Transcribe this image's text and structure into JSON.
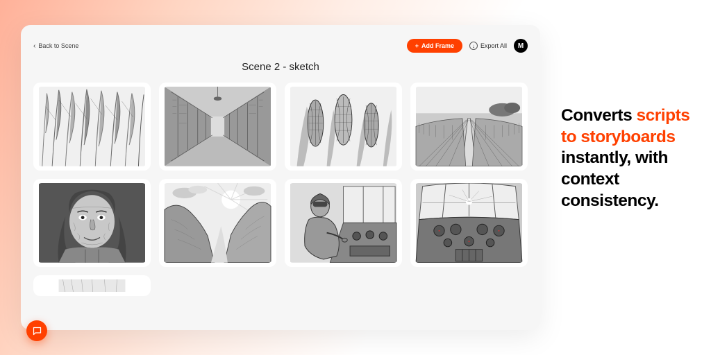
{
  "topbar": {
    "back_label": "Back to Scene",
    "add_frame_label": "Add Frame",
    "export_label": "Export All",
    "avatar_letter": "M"
  },
  "scene_title": "Scene 2 - sketch",
  "frames": [
    {
      "alt": "corn-stalks-closeup"
    },
    {
      "alt": "library-hallway"
    },
    {
      "alt": "corn-ears-closeup"
    },
    {
      "alt": "cornfield-rows-landscape"
    },
    {
      "alt": "elderly-woman-portrait"
    },
    {
      "alt": "mountain-valley-sunlight"
    },
    {
      "alt": "pilot-in-cockpit"
    },
    {
      "alt": "cockpit-interior-view"
    }
  ],
  "headline": {
    "line1": "Converts",
    "accent": "scripts to storyboards",
    "rest": "instantly, with context consistency."
  },
  "colors": {
    "accent": "#ff4000"
  }
}
